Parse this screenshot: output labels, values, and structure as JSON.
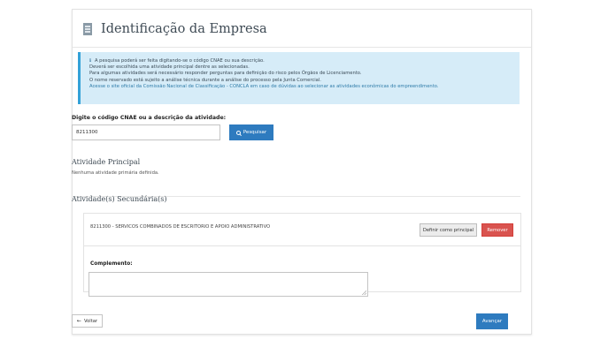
{
  "page": {
    "title": "Identificação da Empresa",
    "icon": "building-icon"
  },
  "info_box": {
    "icon": "info-icon",
    "lines": [
      "A pesquisa poderá ser feita digitando-se o código CNAE ou sua descrição.",
      "Deverá ser escolhida uma atividade principal dentre as selecionadas.",
      "Para algumas atividades será necessário responder perguntas para definição do risco pelos Órgãos de Licenciamento.",
      "O nome reservado está sujeito a análise técnica durante a análise do processo pela Junta Comercial."
    ],
    "link_text": "Acesse o site oficial da Comissão Nacional de Classificação - CONCLA em caso de dúvidas ao selecionar as atividades econômicas do empreendimento."
  },
  "search": {
    "label": "Digite o código CNAE ou a descrição da atividade:",
    "value": "8211300",
    "button_label": "Pesquisar"
  },
  "principal": {
    "heading": "Atividade Principal",
    "empty_text": "Nenhuma atividade primária definida."
  },
  "secondary": {
    "heading": "Atividade(s) Secundária(s)",
    "items": [
      {
        "text": "8211300 - SERVICOS COMBINADOS DE ESCRITORIO E APOIO ADMINISTRATIVO",
        "set_principal_label": "Definir como principal",
        "remove_label": "Remover"
      }
    ],
    "complement_label": "Complemento:",
    "complement_value": ""
  },
  "nav": {
    "back_label": "Voltar",
    "next_label": "Avançar"
  },
  "colors": {
    "primary": "#2e7bbf",
    "danger": "#d9534f",
    "info_bg": "#d6ecf8",
    "info_border": "#33a1d8"
  }
}
